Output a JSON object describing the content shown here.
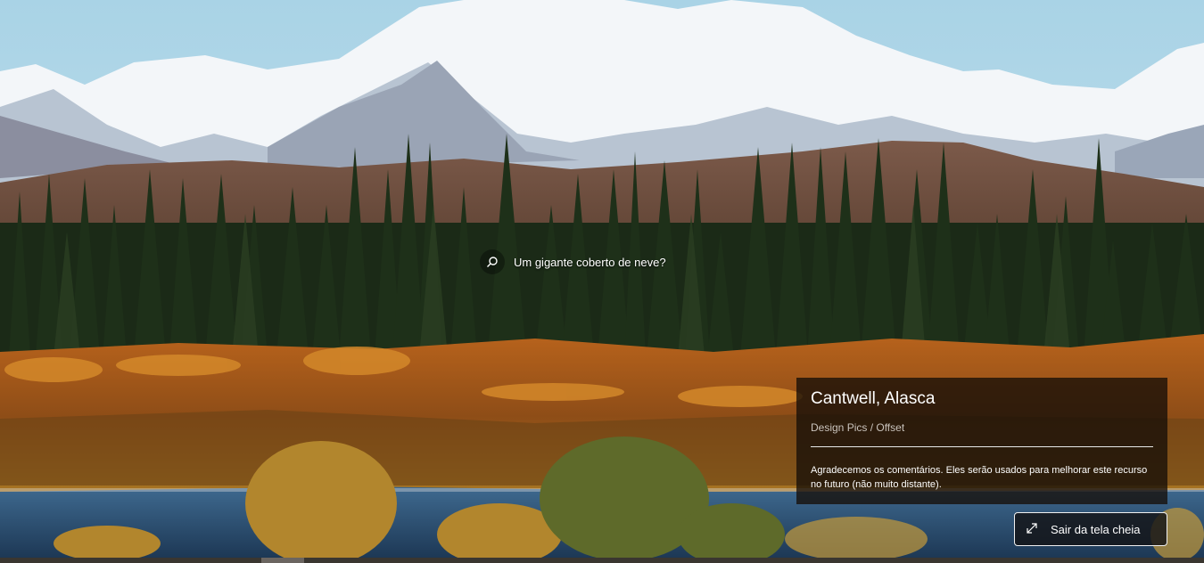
{
  "search": {
    "icon": "search-icon",
    "text": "Um gigante coberto de neve?"
  },
  "info_card": {
    "title": "Cantwell, Alasca",
    "credit": "Design Pics / Offset",
    "feedback": "Agradecemos os comentários. Eles serão usados para melhorar este recurso no futuro (não muito distante)."
  },
  "exit_fullscreen": {
    "icon": "expand-arrows-icon",
    "label": "Sair da tela cheia"
  },
  "colors": {
    "sky": "#b9dbe9",
    "snow": "#f4f7fa",
    "forest": "#1c2c18",
    "autumn": "#a35e1c",
    "lake": "#2c4e70"
  }
}
